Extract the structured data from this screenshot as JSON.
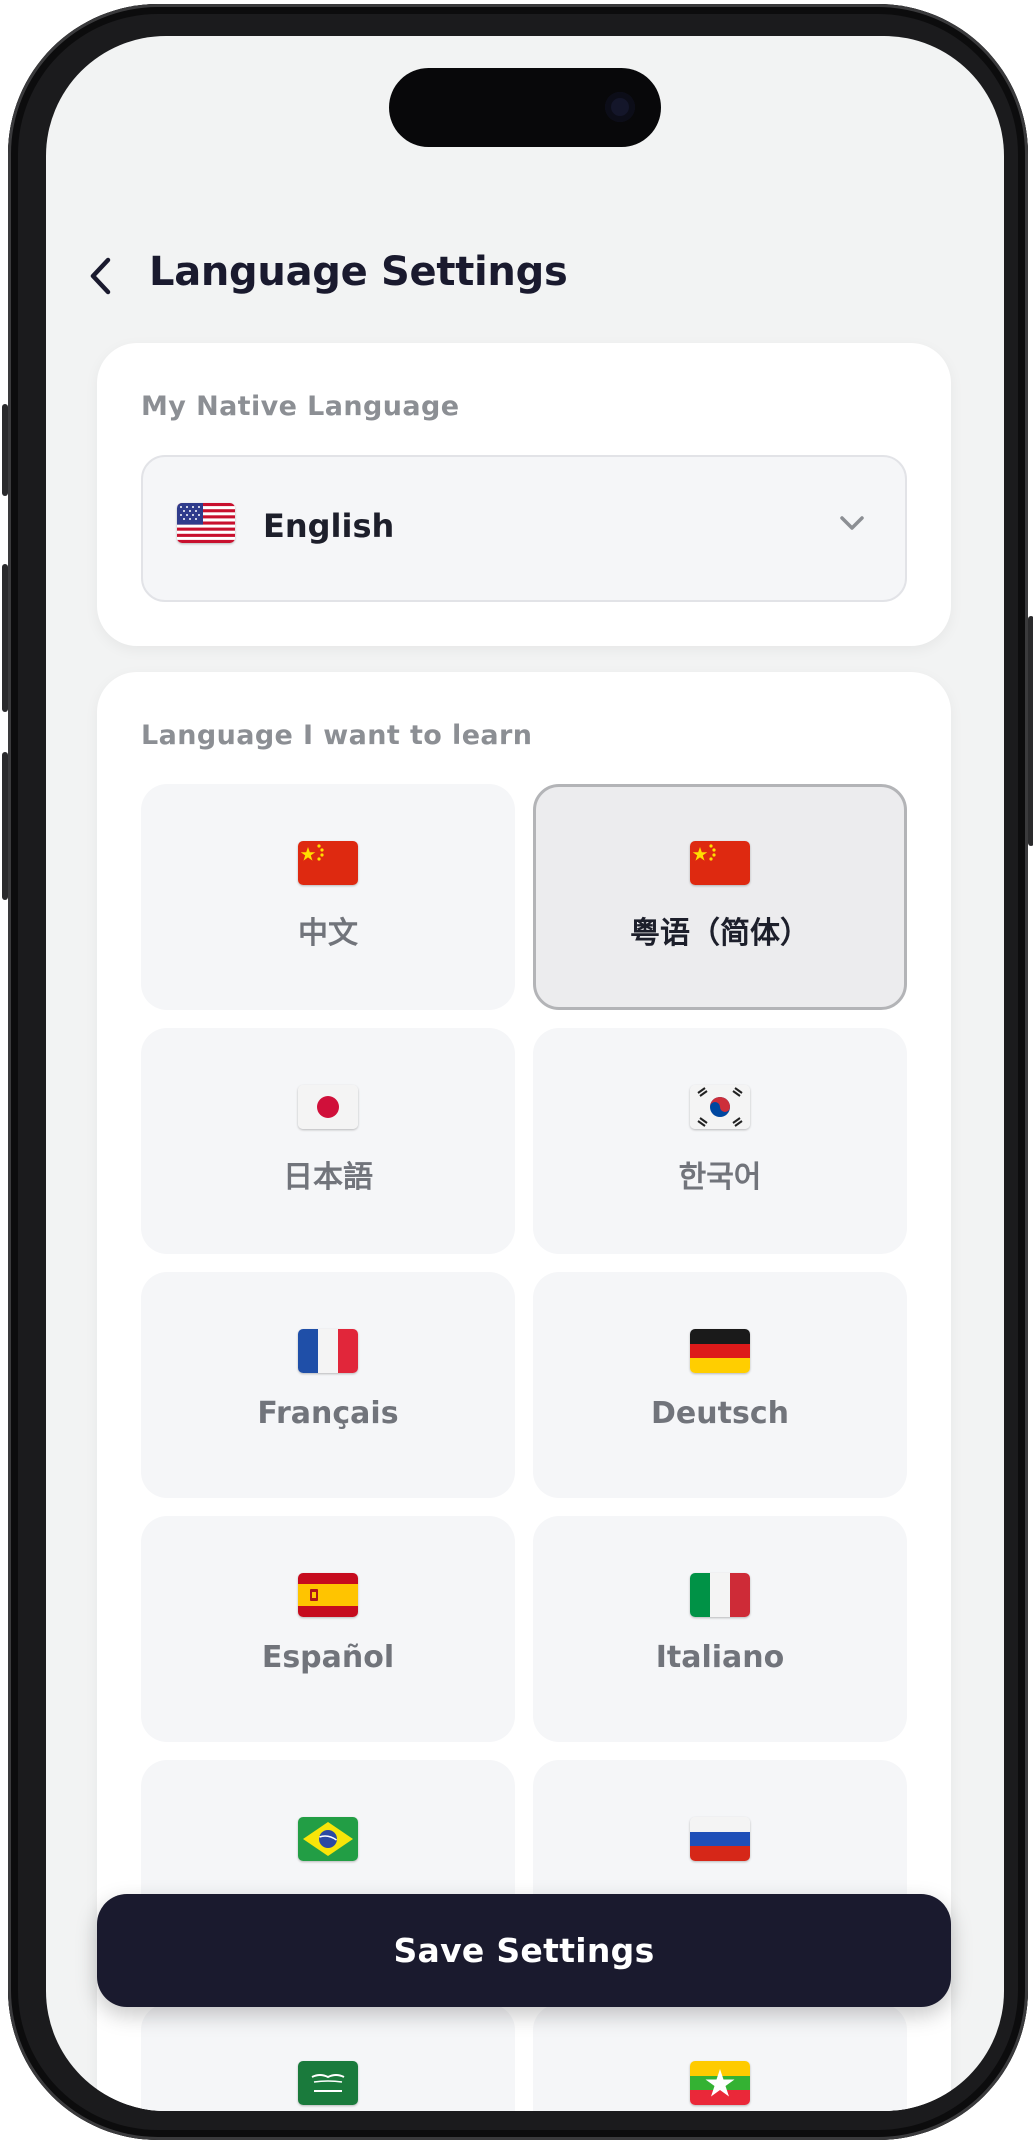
{
  "header": {
    "title": "Language Settings"
  },
  "native_section": {
    "label": "My Native Language",
    "selected": {
      "name": "English",
      "flag_icon": "us-flag-icon"
    }
  },
  "learn_section": {
    "label": "Language I want to learn",
    "languages": [
      {
        "label": "中文",
        "flag_icon": "china-flag-icon",
        "selected": false
      },
      {
        "label": "粤语（简体）",
        "flag_icon": "china-flag-icon",
        "selected": true
      },
      {
        "label": "日本語",
        "flag_icon": "japan-flag-icon",
        "selected": false
      },
      {
        "label": "한국어",
        "flag_icon": "korea-flag-icon",
        "selected": false
      },
      {
        "label": "Français",
        "flag_icon": "france-flag-icon",
        "selected": false
      },
      {
        "label": "Deutsch",
        "flag_icon": "germany-flag-icon",
        "selected": false
      },
      {
        "label": "Español",
        "flag_icon": "spain-flag-icon",
        "selected": false
      },
      {
        "label": "Italiano",
        "flag_icon": "italy-flag-icon",
        "selected": false
      },
      {
        "label": "",
        "flag_icon": "brazil-flag-icon",
        "selected": false
      },
      {
        "label": "",
        "flag_icon": "russia-flag-icon",
        "selected": false
      },
      {
        "label": "",
        "flag_icon": "saudi-arabia-flag-icon",
        "selected": false
      },
      {
        "label": "",
        "flag_icon": "myanmar-flag-icon",
        "selected": false
      }
    ]
  },
  "footer": {
    "save_label": "Save Settings"
  },
  "colors": {
    "primary": "#1a1a2e",
    "background": "#f2f3f3",
    "tile": "#f5f6f8",
    "tile_selected": "#ececee",
    "label": "#8c8f94"
  }
}
